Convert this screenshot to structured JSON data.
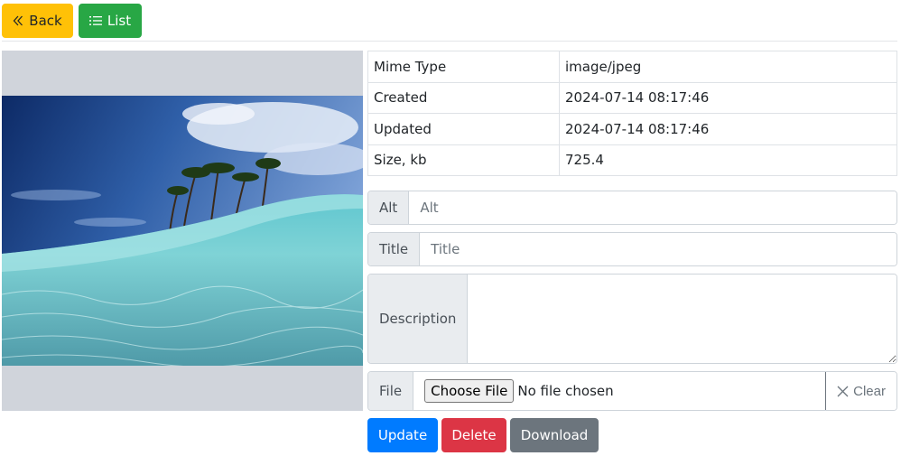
{
  "toolbar": {
    "back_label": "Back",
    "back_icon": "double-chevron-left-icon",
    "list_label": "List",
    "list_icon": "list-icon"
  },
  "image": {
    "alt": "Tropical island with palm trees and turquoise water",
    "description": "Split-level ocean photo: island with palm trees above, clear turquoise water below"
  },
  "info": {
    "rows": [
      {
        "key": "Mime Type",
        "value": "image/jpeg"
      },
      {
        "key": "Created",
        "value": "2024-07-14 08:17:46"
      },
      {
        "key": "Updated",
        "value": "2024-07-14 08:17:46"
      },
      {
        "key": "Size, kb",
        "value": "725.4"
      }
    ]
  },
  "form": {
    "alt": {
      "label": "Alt",
      "value": "",
      "placeholder": "Alt"
    },
    "title": {
      "label": "Title",
      "value": "",
      "placeholder": "Title"
    },
    "description": {
      "label": "Description",
      "value": "",
      "placeholder": ""
    },
    "file": {
      "label": "File",
      "choose_label": "Choose File",
      "status": "No file chosen",
      "clear_label": "Clear",
      "clear_icon": "x-icon"
    }
  },
  "actions": {
    "update_label": "Update",
    "delete_label": "Delete",
    "download_label": "Download"
  },
  "colors": {
    "warning": "#ffc107",
    "success": "#28a745",
    "primary": "#007bff",
    "danger": "#dc3545",
    "secondary": "#6c757d"
  }
}
